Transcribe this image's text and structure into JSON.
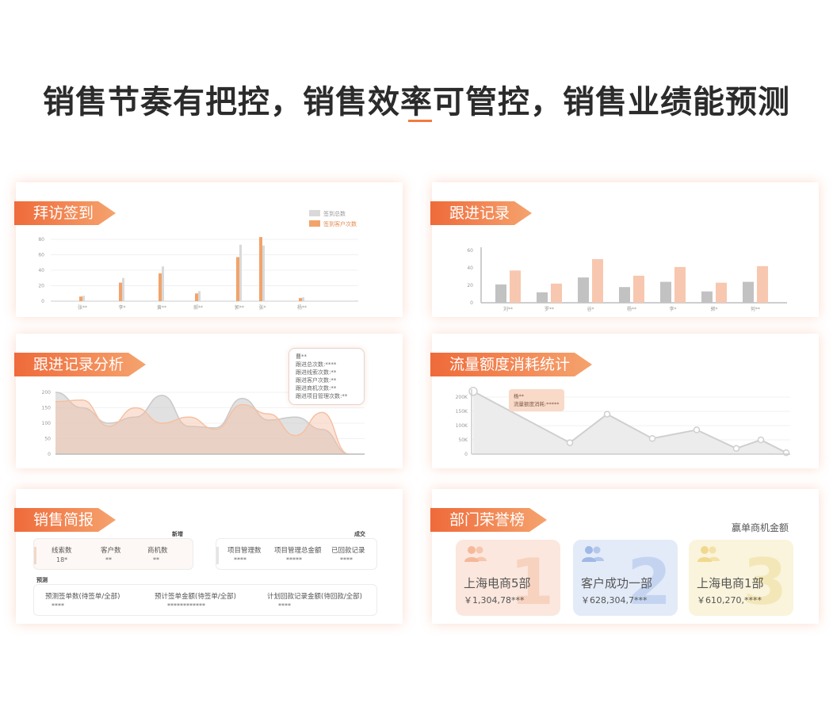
{
  "page": {
    "title": "销售节奏有把控，销售效率可管控，销售业绩能预测",
    "accent": "#f07b3f"
  },
  "visit_checkin": {
    "title": "拜访签到",
    "legend": [
      "签到总数",
      "签到客户次数"
    ],
    "chart_data": {
      "type": "bar",
      "categories": [
        "张**",
        "李*",
        "黄**",
        "郝**",
        "郭**",
        "张*",
        "杨**"
      ],
      "y_ticks": [
        "0",
        "20",
        "40",
        "60",
        "80"
      ],
      "ylim": [
        0,
        80
      ],
      "series": [
        {
          "name": "签到总数",
          "values": [
            7,
            30,
            45,
            13,
            73,
            72,
            5
          ],
          "color": "#d9d9d9"
        },
        {
          "name": "签到客户次数",
          "values": [
            6,
            24,
            36,
            10,
            57,
            83,
            4
          ],
          "color": "#f2a36b"
        }
      ]
    }
  },
  "follow_record": {
    "title": "跟进记录",
    "chart_data": {
      "type": "bar",
      "categories": [
        "刘**",
        "罗**",
        "谷*",
        "杨**",
        "李*",
        "郭*",
        "何**"
      ],
      "y_ticks": [
        "0",
        "20",
        "40",
        "60"
      ],
      "ylim": [
        0,
        60
      ],
      "series": [
        {
          "values": [
            21,
            12,
            29,
            18,
            24,
            13,
            24
          ],
          "color": "#c2c2c2"
        },
        {
          "values": [
            37,
            22,
            50,
            31,
            41,
            23,
            42
          ],
          "color": "#f7c7b0"
        }
      ]
    }
  },
  "follow_analysis": {
    "title": "跟进记录分析",
    "tooltip": {
      "name": "曹**",
      "lines": [
        "跟进总次数:****",
        "跟进线索次数:**",
        "跟进客户次数:**",
        "跟进商机次数:**",
        "跟进项目管理次数:**"
      ]
    },
    "chart_data": {
      "type": "area",
      "y_ticks": [
        "0",
        "50",
        "100",
        "150",
        "200"
      ],
      "ylim": [
        0,
        200
      ],
      "series": [
        {
          "values": [
            200,
            150,
            100,
            120,
            190,
            90,
            85,
            180,
            110,
            120,
            80,
            0
          ],
          "color": "#c9c9c9"
        },
        {
          "values": [
            170,
            175,
            90,
            150,
            100,
            120,
            80,
            160,
            130,
            60,
            135,
            0
          ],
          "color": "#f5c0a3"
        }
      ]
    }
  },
  "traffic": {
    "title": "流量额度消耗统计",
    "tooltip": {
      "name": "杨**",
      "line": "流量额度消耗:*****"
    },
    "chart_data": {
      "type": "area",
      "y_ticks": [
        "0",
        "50K",
        "100K",
        "150K",
        "200K"
      ],
      "ylim": [
        0,
        200000
      ],
      "values": [
        220000,
        40000,
        140000,
        55000,
        85000,
        20000,
        50000,
        5000
      ],
      "color": "#cfcfcf"
    }
  },
  "sales_report": {
    "title": "销售简报",
    "group_new": "新增",
    "group_deal": "成交",
    "group_forecast": "预测",
    "new_items": [
      {
        "label": "线索数",
        "value": "18*"
      },
      {
        "label": "客户数",
        "value": "**"
      },
      {
        "label": "商机数",
        "value": "**"
      }
    ],
    "deal_items": [
      {
        "label": "项目管理数",
        "value": "****"
      },
      {
        "label": "项目管理总金额",
        "value": "*****"
      },
      {
        "label": "已回款记录",
        "value": "****"
      }
    ],
    "forecast_items": [
      {
        "label": "预测签单数(待签单/全部)",
        "value": "****"
      },
      {
        "label": "预计签单金额(待签单/全部)",
        "value": "************"
      },
      {
        "label": "计划回款记录金额(待回款/全部)",
        "value": "****"
      }
    ]
  },
  "honor": {
    "title": "部门荣誉榜",
    "subtitle": "赢单商机金额",
    "departments": [
      {
        "rank": "1",
        "name": "上海电商5部",
        "amount": "￥1,304,78***",
        "bg": "#fbe7dd",
        "icon": "#f5b89a",
        "rank_color": "#f6d2bf"
      },
      {
        "rank": "2",
        "name": "客户成功一部",
        "amount": "￥628,304,7***",
        "bg": "#e3ebf8",
        "icon": "#9fb8e6",
        "rank_color": "#c4d4f0"
      },
      {
        "rank": "3",
        "name": "上海电商1部",
        "amount": "￥610,270,****",
        "bg": "#faf4dc",
        "icon": "#f0d98e",
        "rank_color": "#f4e7b7"
      }
    ]
  }
}
